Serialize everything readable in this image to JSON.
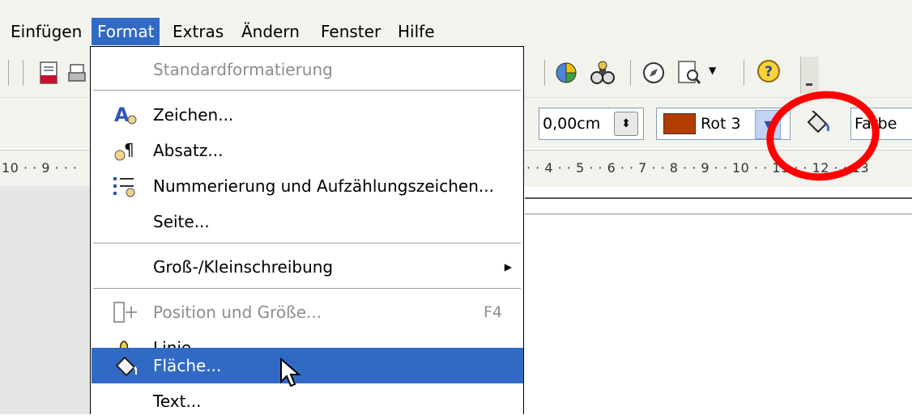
{
  "menubar": {
    "items": [
      {
        "label": "Einfügen"
      },
      {
        "label": "Format"
      },
      {
        "label": "Extras"
      },
      {
        "label": "Ändern"
      },
      {
        "label": "Fenster"
      },
      {
        "label": "Hilfe"
      }
    ]
  },
  "toolbar2": {
    "line_width": "0,00cm",
    "fill_color_name": "Rot 3",
    "fill_color": "#b33c00",
    "area_style": "Farbe"
  },
  "ruler": {
    "left_text": "10 · · 9 · · ·",
    "right_text": "· · 4 · · 5 · · 6 · · 7 · · 8 · · 9 · · 10 · · 11 · · 12 · · 13"
  },
  "menu": {
    "items": [
      {
        "label": "Standardformatierung",
        "icon": "none",
        "disabled": true
      },
      {
        "label": "Zeichen...",
        "icon": "character-icon"
      },
      {
        "label": "Absatz...",
        "icon": "paragraph-icon"
      },
      {
        "label": "Nummerierung und Aufzählungszeichen...",
        "icon": "numbering-icon"
      },
      {
        "label": "Seite...",
        "icon": "none"
      },
      {
        "label": "Groß-/Kleinschreibung",
        "icon": "none",
        "submenu": true
      },
      {
        "label": "Position und Größe...",
        "icon": "position-size-icon",
        "shortcut": "F4",
        "disabled": true
      },
      {
        "label": "Linie...",
        "icon": "line-icon"
      },
      {
        "label": "Fläche...",
        "icon": "area-fill-icon",
        "selected": true
      },
      {
        "label": "Text...",
        "icon": "none"
      }
    ]
  },
  "colors": {
    "highlight": "#316ac5",
    "annotation": "#ff0000"
  }
}
